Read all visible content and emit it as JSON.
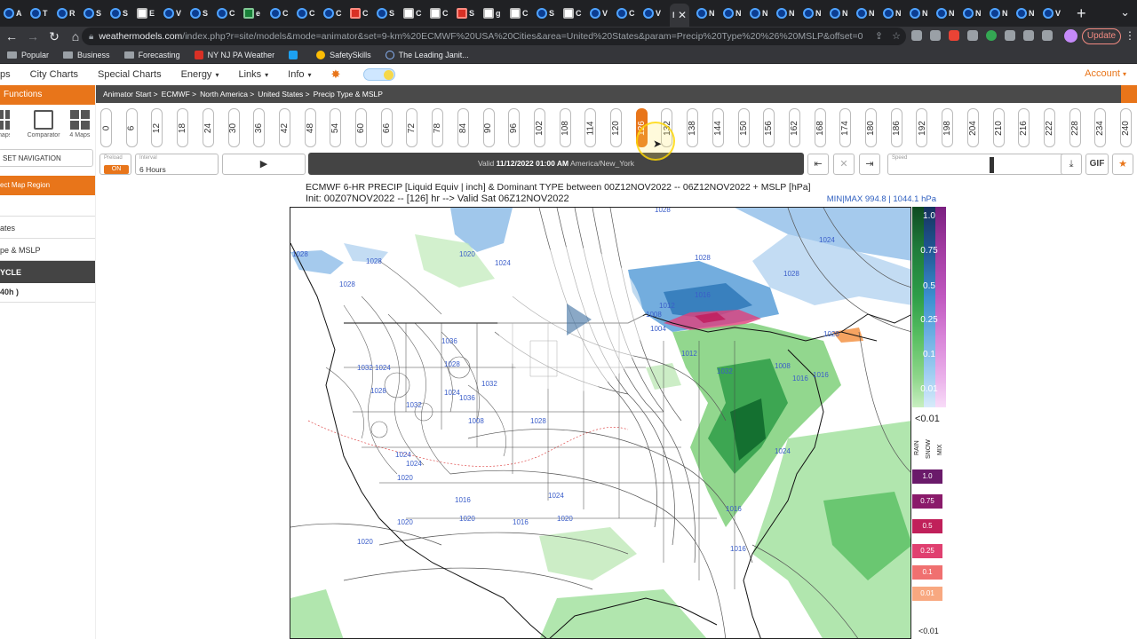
{
  "browser": {
    "tabs": [
      {
        "letter": "A",
        "icon": "noaa"
      },
      {
        "letter": "T",
        "icon": "noaa"
      },
      {
        "letter": "R",
        "icon": "noaa"
      },
      {
        "letter": "S",
        "icon": "noaa"
      },
      {
        "letter": "S",
        "icon": "noaa"
      },
      {
        "letter": "E",
        "icon": "white"
      },
      {
        "letter": "V",
        "icon": "noaa"
      },
      {
        "letter": "S",
        "icon": "noaa"
      },
      {
        "letter": "C",
        "icon": "noaa"
      },
      {
        "letter": "e",
        "icon": "green"
      },
      {
        "letter": "C",
        "icon": "noaa"
      },
      {
        "letter": "C",
        "icon": "noaa"
      },
      {
        "letter": "C",
        "icon": "noaa"
      },
      {
        "letter": "C",
        "icon": "red"
      },
      {
        "letter": "S",
        "icon": "noaa"
      },
      {
        "letter": "C",
        "icon": "white"
      },
      {
        "letter": "C",
        "icon": "white"
      },
      {
        "letter": "S",
        "icon": "red"
      },
      {
        "letter": "g",
        "icon": "white"
      },
      {
        "letter": "C",
        "icon": "white"
      },
      {
        "letter": "S",
        "icon": "noaa"
      },
      {
        "letter": "C",
        "icon": "white"
      },
      {
        "letter": "V",
        "icon": "noaa"
      },
      {
        "letter": "C",
        "icon": "noaa"
      },
      {
        "letter": "V",
        "icon": "noaa"
      }
    ],
    "active_tab": {
      "letter": "M",
      "close": "✕"
    },
    "tabs_after": [
      "N",
      "N",
      "N",
      "N",
      "N",
      "N",
      "N",
      "N",
      "N",
      "N",
      "N",
      "N",
      "N",
      "V"
    ],
    "new_tab": "+",
    "url_host": "weathermodels.com",
    "url_path": "/index.php?r=site/models&mode=animator&set=9-km%20ECMWF%20USA%20Cities&area=United%20States&param=Precip%20Type%20%26%20MSLP&offset=0",
    "update_label": "Update",
    "bookmarks": [
      {
        "label": "Popular",
        "icon": "folder"
      },
      {
        "label": "Business",
        "icon": "folder"
      },
      {
        "label": "Forecasting",
        "icon": "folder"
      },
      {
        "label": "NY NJ PA Weather",
        "icon": "nj"
      },
      {
        "label": "",
        "icon": "tw"
      },
      {
        "label": "SafetySkills",
        "icon": "ss"
      },
      {
        "label": "The Leading Janit...",
        "icon": "lj"
      }
    ]
  },
  "site_nav": {
    "items": [
      {
        "label": "ps",
        "caret": false
      },
      {
        "label": "City Charts",
        "caret": false
      },
      {
        "label": "Special Charts",
        "caret": false
      },
      {
        "label": "Energy",
        "caret": true
      },
      {
        "label": "Links",
        "caret": true
      },
      {
        "label": "Info",
        "caret": true
      }
    ],
    "account": "Account"
  },
  "sidebar": {
    "header": "Functions",
    "tools": [
      {
        "label": "maps"
      },
      {
        "label": "Comparator"
      },
      {
        "label": "4 Maps"
      }
    ],
    "reset_nav": "SET NAVIGATION",
    "select_region": "ect Map Region",
    "items": [
      "",
      "ates",
      "pe & MSLP"
    ],
    "cycle": "YCLE",
    "cycle_sub": "40h )"
  },
  "breadcrumb": [
    "Animator Start >",
    "ECMWF >",
    "North America >",
    "United States >",
    "Precip Type & MSLP"
  ],
  "hours": {
    "values": [
      "0",
      "6",
      "12",
      "18",
      "24",
      "30",
      "36",
      "42",
      "48",
      "54",
      "60",
      "66",
      "72",
      "78",
      "84",
      "90",
      "96",
      "102",
      "108",
      "114",
      "120",
      "126",
      "132",
      "138",
      "144",
      "150",
      "156",
      "162",
      "168",
      "174",
      "180",
      "186",
      "192",
      "198",
      "204",
      "210",
      "216",
      "222",
      "228",
      "234",
      "240"
    ],
    "active": "126"
  },
  "controls": {
    "preload_label": "Preload",
    "preload_value": "ON",
    "interval_label": "Interval",
    "interval_value": "6 Hours",
    "play_symbol": "▶",
    "valid_prefix": "Valid ",
    "valid_time": "11/12/2022 01:00 AM",
    "valid_tz": " America/New_York",
    "speed_label": "Speed",
    "gif_label": "GIF"
  },
  "chart": {
    "title_line1": "ECMWF 6-HR PRECIP [Liquid Equiv | inch] & Dominant TYPE between 00Z12NOV2022 -- 06Z12NOV2022 + MSLP [hPa]",
    "title_line2": "Init: 00Z07NOV2022 -- [126] hr --> Valid Sat 06Z12NOV2022",
    "minmax": "MIN|MAX 994.8 | 1044.1 hPa",
    "isobar_labels": [
      "1028",
      "1028",
      "1020",
      "1024",
      "1028",
      "1028",
      "1024",
      "1020",
      "1028",
      "1028",
      "1016",
      "1012",
      "1008",
      "1004",
      "1032",
      "1036",
      "1032",
      "1024",
      "1028",
      "1024",
      "1028",
      "1032",
      "1036",
      "1032",
      "1024",
      "1024",
      "1020",
      "1020",
      "1020",
      "1016",
      "1016",
      "1024",
      "1020",
      "1016",
      "1016",
      "1020",
      "1008",
      "1016",
      "1016",
      "1024",
      "1028",
      "1008",
      "1012"
    ],
    "colors": {
      "rain": "#2e9e48",
      "snow": "#3b8fd0",
      "mix": "#e0407a"
    }
  },
  "legend": {
    "main_ticks": [
      "1.0",
      "0.75",
      "0.5",
      "0.25",
      "0.1",
      "0.01"
    ],
    "below_label": "<0.01",
    "type_labels": [
      "RAIN",
      "SNOW",
      "MIX"
    ],
    "mix_ticks": [
      "1.0",
      "0.75",
      "0.5",
      "0.25",
      "0.1",
      "0.01"
    ],
    "mix_below": "<0.01"
  }
}
